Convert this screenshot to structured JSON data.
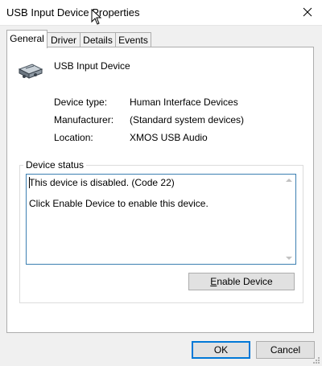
{
  "window": {
    "title": "USB Input Device Properties",
    "close_icon": "close-icon"
  },
  "tabs": [
    {
      "label": "General",
      "selected": true
    },
    {
      "label": "Driver",
      "selected": false
    },
    {
      "label": "Details",
      "selected": false
    },
    {
      "label": "Events",
      "selected": false
    }
  ],
  "device": {
    "icon": "usb-device-icon",
    "name": "USB Input Device"
  },
  "properties": [
    {
      "label": "Device type:",
      "value": "Human Interface Devices"
    },
    {
      "label": "Manufacturer:",
      "value": "(Standard system devices)"
    },
    {
      "label": "Location:",
      "value": "XMOS USB Audio"
    }
  ],
  "device_status": {
    "group_label": "Device status",
    "line1": "This device is disabled. (Code 22)",
    "line2": "Click Enable Device to enable this device."
  },
  "buttons": {
    "enable_device": {
      "label": "Enable Device",
      "access_key": "E"
    },
    "ok": "OK",
    "cancel": "Cancel"
  },
  "colors": {
    "accent": "#0078d7",
    "window_bg": "#f0f0f0",
    "panel_bg": "#ffffff"
  }
}
